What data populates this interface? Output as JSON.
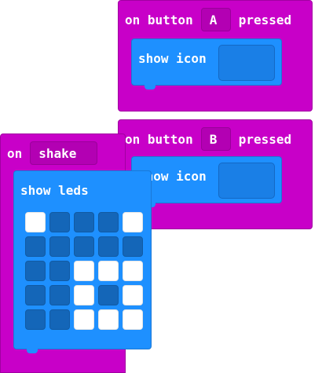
{
  "blocks": {
    "button_a": {
      "event": "on button",
      "button": "A",
      "suffix": "pressed",
      "action": "show icon"
    },
    "button_b": {
      "event": "on button",
      "button": "B",
      "suffix": "pressed",
      "action": "show icon"
    },
    "shake": {
      "event": "on",
      "gesture": "shake",
      "action": "show leds",
      "leds": [
        [
          1,
          0,
          0,
          0,
          1
        ],
        [
          0,
          0,
          0,
          0,
          0
        ],
        [
          0,
          0,
          1,
          1,
          1
        ],
        [
          0,
          0,
          1,
          0,
          1
        ],
        [
          0,
          0,
          1,
          1,
          1
        ]
      ]
    }
  },
  "colors": {
    "event_block": "#c800c8",
    "basic_block": "#1e90ff",
    "led_on": "#ffffff",
    "led_off": "#1466b8"
  }
}
